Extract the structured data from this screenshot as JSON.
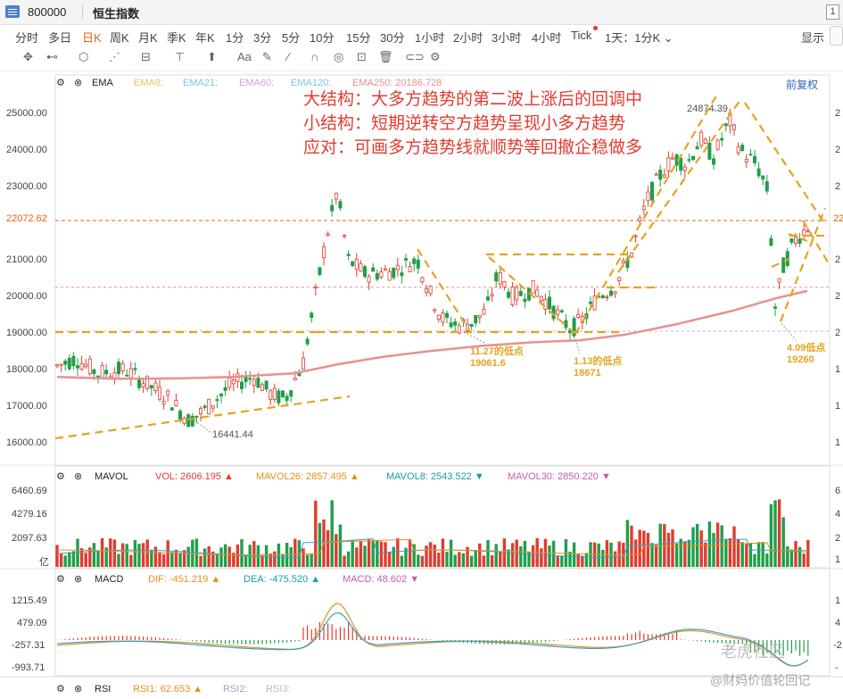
{
  "window": {
    "code": "800000",
    "name": "恒生指数",
    "page_number": "1"
  },
  "periods": [
    "分时",
    "多日",
    "日K",
    "周K",
    "月K",
    "季K",
    "年K",
    "1分",
    "3分",
    "5分",
    "10分",
    "15分",
    "30分",
    "1小时",
    "2小时",
    "3小时",
    "4小时",
    "Tick",
    "1天：1分K ⌄"
  ],
  "active_period": "日K",
  "display_menu": "显示 ⌄",
  "price_axis": {
    "labels": [
      "25000.00",
      "24000.00",
      "23000.00",
      "22072.62",
      "21000.00",
      "20000.00",
      "19000.00",
      "18000.00",
      "17000.00",
      "16000.00"
    ],
    "current_price": "22072.62",
    "right_edge_labels": [
      "2",
      "2",
      "2",
      "22",
      "2",
      "2",
      "2",
      "1",
      "1",
      "1"
    ]
  },
  "ema_header": {
    "name": "EMA",
    "items": [
      "EMA8:",
      "EMA21:",
      "EMA60:",
      "EMA120:",
      "EMA250:  20186.728"
    ],
    "restore_label": "前复权"
  },
  "annotations": {
    "line1": "大结构：大多方趋势的第二波上涨后的回调中",
    "line2": "小结构：短期逆转空方趋势呈现小多方趋势",
    "line3": "应对：可画多方趋势线就顺势等回撤企稳做多"
  },
  "price_marks": {
    "high": "24874.39",
    "low": "16441.44",
    "low_1127_label": "11.27的低点",
    "low_1127_value": "19061.6",
    "low_113_label": "1.13的低点",
    "low_113_value": "18671",
    "low_409_label": "4.09低点",
    "low_409_value": "19260"
  },
  "mavol_header": {
    "name": "MAVOL",
    "vol": "VOL:  2606.195 ▲",
    "mavol26": "MAVOL26:  2857.495 ▲",
    "mavol8": "MAVOL8:  2543.522 ▼",
    "mavol30": "MAVOL30:  2850.220 ▼"
  },
  "vol_axis": {
    "labels": [
      "6460.69",
      "4279.16",
      "2097.63",
      "亿"
    ],
    "right_labels": [
      "6",
      "4",
      "2",
      "1"
    ]
  },
  "macd_header": {
    "name": "MACD",
    "dif": "DIF:  -451.219 ▲",
    "dea": "DEA:  -475.520 ▲",
    "macd": "MACD:  48.602 ▼"
  },
  "macd_axis": {
    "labels": [
      "1215.49",
      "479.09",
      "-257.31",
      "-993.71"
    ],
    "right_labels": [
      "1",
      "4",
      "-2",
      "-"
    ]
  },
  "rsi_header": {
    "name": "RSI",
    "rsi1": "RSI1:  62.653 ▲",
    "rsi2": "RSI2:",
    "rsi3": "RSI3:"
  },
  "watermark": {
    "brand": "老虎社区",
    "author": "@财妈价值轮回记"
  },
  "colors": {
    "up": "#e23b2e",
    "down": "#1f9e49",
    "trend": "#e6a21f",
    "ema": "#e89090",
    "dif": "#e0921f",
    "dea": "#3aa0c8",
    "accent": "#e0660c",
    "link": "#2b65c5"
  },
  "chart_data": {
    "type": "candlestick",
    "series": [
      {
        "name": "EMA250",
        "approx_values": [
          17800,
          17750,
          17800,
          17900,
          18100,
          18350,
          18550,
          18750,
          18850,
          18950,
          19050,
          19250,
          19600,
          19900,
          20100,
          20186
        ]
      }
    ],
    "ylim": [
      16000,
      25500
    ],
    "key_prices": {
      "high": 24874.39,
      "low": 16441.44,
      "low_1127": 19061.6,
      "low_113": 18671,
      "low_409": 19260,
      "current": 22072.62
    }
  }
}
